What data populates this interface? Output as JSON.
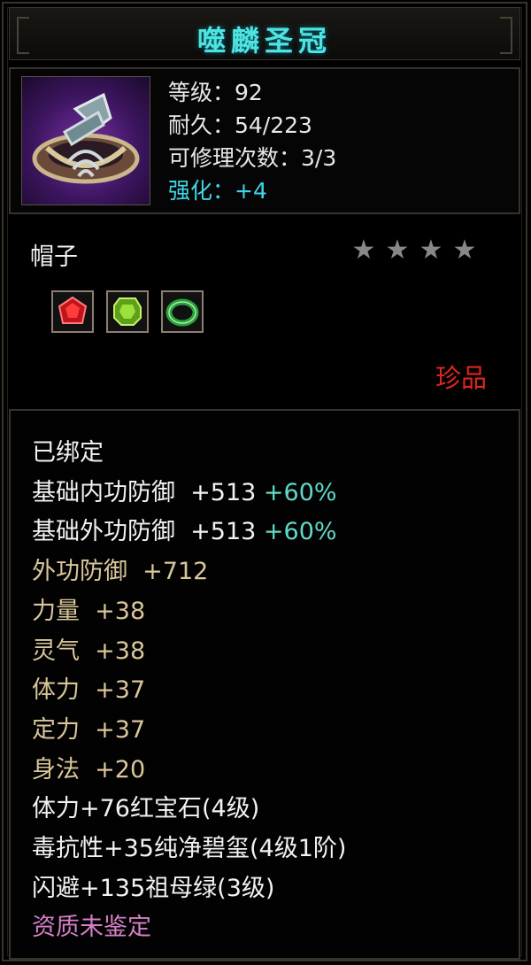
{
  "item": {
    "title": "噬麟圣冠",
    "icon": "crown-icon",
    "level": "等级：92",
    "durability": "耐久：54/223",
    "repair": "可修理次数：3/3",
    "enhance": "强化：+4",
    "type": "帽子",
    "stars": 4,
    "rarity": "珍品"
  },
  "gems": [
    {
      "icon": "ruby-gem-icon",
      "color": "#d8242c"
    },
    {
      "icon": "peridot-gem-icon",
      "color": "#8fd12a"
    },
    {
      "icon": "emerald-ring-icon",
      "color": "#2fa83c"
    }
  ],
  "attributes": {
    "bound": "已绑定",
    "base_inner_def": "基础内功防御  +513",
    "base_inner_def_bonus": "+60%",
    "base_outer_def": "基础外功防御  +513",
    "base_outer_def_bonus": "+60%",
    "outer_def": "外功防御  +712",
    "strength": "力量  +38",
    "spirit": "灵气  +38",
    "stamina": "体力  +37",
    "focus": "定力  +37",
    "agility": "身法  +20",
    "gem1": "体力+76红宝石(4级)",
    "gem2": "毒抗性+35纯净碧玺(4级1阶)",
    "gem3": "闪避+135祖母绿(3级)",
    "quality": "资质未鉴定"
  },
  "colors": {
    "title": "#4fe3e0",
    "enhance": "#3ed6e6",
    "rarity": "#e0241f",
    "stat": "#d9c69a",
    "bonus": "#5fd9c9",
    "quality": "#d77fc8"
  }
}
